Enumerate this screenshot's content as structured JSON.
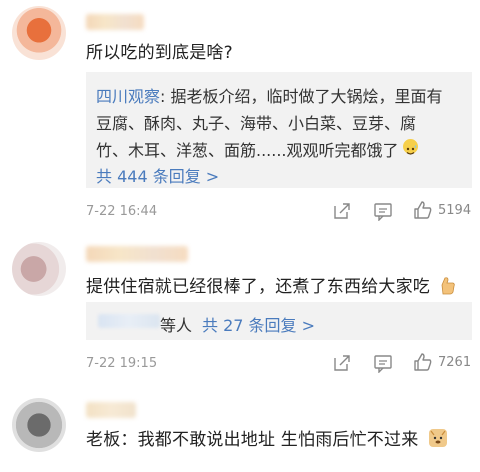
{
  "comments": [
    {
      "text": "所以吃的到底是啥?",
      "reply": {
        "author": "四川观察",
        "body_lines": [
          ": 据老板介绍，临时做了大锅烩，里面有",
          "豆腐、酥肉、丸子、海带、小白菜、豆芽、腐",
          "竹、木耳、洋葱、面筋......观观听完都饿了"
        ],
        "emoji": "sweat-smile-emoji",
        "link": "共 444 条回复 >"
      },
      "time": "7-22 16:44",
      "likes": "5194"
    },
    {
      "text": "提供住宿就已经很棒了，还煮了东西给大家吃",
      "emoji": "thumbs-up-emoji",
      "reply": {
        "suffix": "等人",
        "link": "共 27 条回复 >"
      },
      "time": "7-22 19:15",
      "likes": "7261"
    },
    {
      "text": "老板：我都不敢说出地址 生怕雨后忙不过来",
      "emoji": "doge-emoji"
    }
  ],
  "icons": {
    "share": "share-icon",
    "comment": "comment-icon",
    "like": "thumbs-up-icon"
  },
  "colors": {
    "link": "#4a7bbd",
    "reply_bg": "#f2f2f2",
    "meta": "#999999"
  }
}
